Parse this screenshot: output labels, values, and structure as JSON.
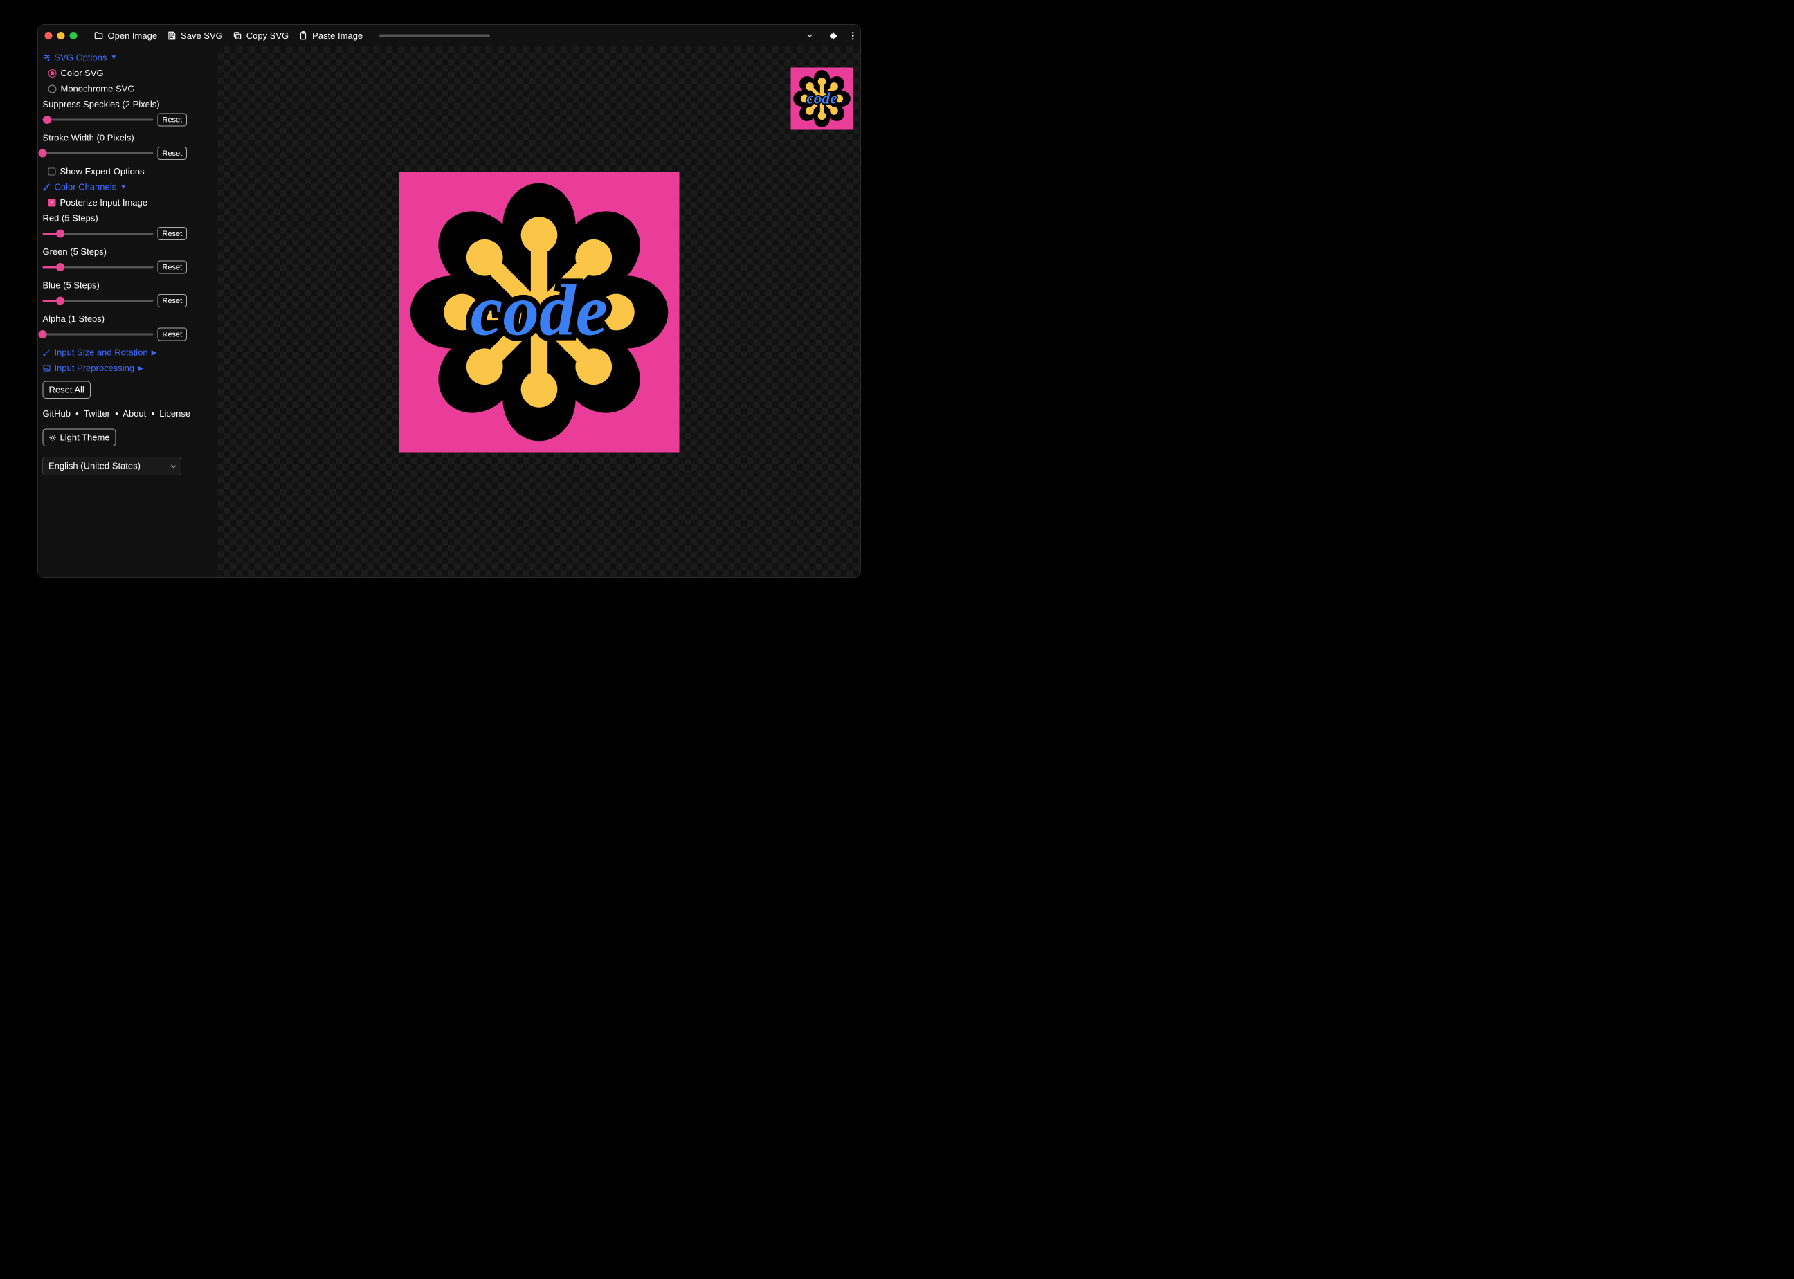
{
  "titlebar": {
    "open_image": "Open Image",
    "save_svg": "Save SVG",
    "copy_svg": "Copy SVG",
    "paste_image": "Paste Image"
  },
  "sections": {
    "svg_options": {
      "title": "SVG Options",
      "radios": {
        "color": "Color SVG",
        "mono": "Monochrome SVG",
        "selected": "color"
      },
      "suppress": {
        "label": "Suppress Speckles (2 Pixels)",
        "percent": 4,
        "reset": "Reset"
      },
      "stroke": {
        "label": "Stroke Width (0 Pixels)",
        "percent": 0,
        "reset": "Reset"
      },
      "expert": {
        "label": "Show Expert Options",
        "checked": false
      }
    },
    "color_channels": {
      "title": "Color Channels",
      "posterize": {
        "label": "Posterize Input Image",
        "checked": true
      },
      "red": {
        "label": "Red (5 Steps)",
        "percent": 16,
        "reset": "Reset"
      },
      "green": {
        "label": "Green (5 Steps)",
        "percent": 16,
        "reset": "Reset"
      },
      "blue": {
        "label": "Blue (5 Steps)",
        "percent": 16,
        "reset": "Reset"
      },
      "alpha": {
        "label": "Alpha (1 Steps)",
        "percent": 0,
        "reset": "Reset"
      }
    },
    "input_size": "Input Size and Rotation",
    "input_preproc": "Input Preprocessing"
  },
  "buttons": {
    "reset_all": "Reset All",
    "light_theme": "Light Theme"
  },
  "links": {
    "github": "GitHub",
    "twitter": "Twitter",
    "about": "About",
    "license": "License"
  },
  "language": "English (United States)",
  "logo": {
    "bg": "#ea3c99",
    "flower": "#fbc647",
    "outline": "#000000",
    "text_fill": "#3a80f4",
    "text": "code"
  }
}
